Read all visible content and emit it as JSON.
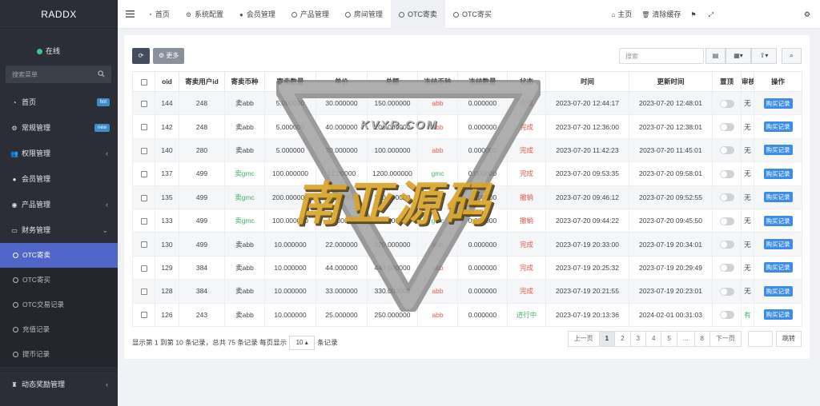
{
  "brand": "RADDX",
  "user": {
    "status": "在线"
  },
  "sidebar_search": {
    "placeholder": "搜索菜单"
  },
  "menu": {
    "home": {
      "label": "首页",
      "badge": "hot"
    },
    "general": {
      "label": "常规管理",
      "badge": "new"
    },
    "permission": {
      "label": "权限管理"
    },
    "member": {
      "label": "会员管理"
    },
    "product": {
      "label": "产品管理"
    },
    "finance": {
      "label": "财务管理"
    },
    "finance_sub": [
      "OTC寄卖",
      "OTC寄买",
      "OTC交易记录",
      "充值记录",
      "提币记录"
    ],
    "reward": {
      "label": "动态奖励管理"
    }
  },
  "tabs": [
    "首页",
    "系统配置",
    "会员管理",
    "产品管理",
    "房间管理",
    "OTC寄卖",
    "OTC寄买"
  ],
  "topright": {
    "home": "主页",
    "clear_cache": "清除缓存"
  },
  "toolbar": {
    "more": "更多"
  },
  "table_search": {
    "placeholder": "搜索"
  },
  "columns": [
    "oid",
    "寄卖用户id",
    "寄卖币种",
    "寄卖数量",
    "单价",
    "总额",
    "冻结币种",
    "冻结数量",
    "状态",
    "时间",
    "更新时间",
    "置顶",
    "审核",
    "操作"
  ],
  "rows": [
    {
      "oid": "144",
      "uid": "248",
      "coin": "卖abb",
      "qty": "5.000000",
      "price": "30.000000",
      "total": "150.000000",
      "fcoin": "abb",
      "fqty": "0.000000",
      "status": "完成",
      "time": "2023-07-20 12:44:17",
      "updated": "2023-07-20 12:48:01",
      "audit": "无",
      "action": "购买记录"
    },
    {
      "oid": "142",
      "uid": "248",
      "coin": "卖abb",
      "qty": "5.000000",
      "price": "40.000000",
      "total": "200.000000",
      "fcoin": "abb",
      "fqty": "0.000000",
      "status": "完成",
      "time": "2023-07-20 12:36:00",
      "updated": "2023-07-20 12:38:01",
      "audit": "无",
      "action": "购买记录"
    },
    {
      "oid": "140",
      "uid": "280",
      "coin": "卖abb",
      "qty": "5.000000",
      "price": "20.000000",
      "total": "100.000000",
      "fcoin": "abb",
      "fqty": "0.000000",
      "status": "完成",
      "time": "2023-07-20 11:42:23",
      "updated": "2023-07-20 11:45:01",
      "audit": "无",
      "action": "购买记录"
    },
    {
      "oid": "137",
      "uid": "499",
      "coin": "卖gmc",
      "qty": "100.000000",
      "price": "12.00000",
      "total": "1200.000000",
      "fcoin": "gmc",
      "fqty": "0.000000",
      "status": "完成",
      "time": "2023-07-20 09:53:35",
      "updated": "2023-07-20 09:58:01",
      "audit": "无",
      "action": "购买记录"
    },
    {
      "oid": "135",
      "uid": "499",
      "coin": "卖gmc",
      "qty": "200.000000",
      "price": "1.000000",
      "total": "200.000000",
      "fcoin": "gmc",
      "fqty": "0.000000",
      "status": "撤销",
      "time": "2023-07-20 09:46:12",
      "updated": "2023-07-20 09:52:55",
      "audit": "无",
      "action": "购买记录"
    },
    {
      "oid": "133",
      "uid": "499",
      "coin": "卖gmc",
      "qty": "100.000000",
      "price": "1.000000",
      "total": "100.000000",
      "fcoin": "gmc",
      "fqty": "0.000000",
      "status": "撤销",
      "time": "2023-07-20 09:44:22",
      "updated": "2023-07-20 09:45:50",
      "audit": "无",
      "action": "购买记录"
    },
    {
      "oid": "130",
      "uid": "499",
      "coin": "卖abb",
      "qty": "10.000000",
      "price": "22.000000",
      "total": "220.000000",
      "fcoin": "abb",
      "fqty": "0.000000",
      "status": "完成",
      "time": "2023-07-19 20:33:00",
      "updated": "2023-07-19 20:34:01",
      "audit": "无",
      "action": "购买记录"
    },
    {
      "oid": "129",
      "uid": "384",
      "coin": "卖abb",
      "qty": "10.000000",
      "price": "44.000000",
      "total": "440.000000",
      "fcoin": "abb",
      "fqty": "0.000000",
      "status": "完成",
      "time": "2023-07-19 20:25:32",
      "updated": "2023-07-19 20:29:49",
      "audit": "无",
      "action": "购买记录"
    },
    {
      "oid": "128",
      "uid": "384",
      "coin": "卖abb",
      "qty": "10.000000",
      "price": "33.000000",
      "total": "330.000000",
      "fcoin": "abb",
      "fqty": "0.000000",
      "status": "完成",
      "time": "2023-07-19 20:21:55",
      "updated": "2023-07-19 20:23:01",
      "audit": "无",
      "action": "购买记录"
    },
    {
      "oid": "126",
      "uid": "243",
      "coin": "卖abb",
      "qty": "10.000000",
      "price": "25.000000",
      "total": "250.000000",
      "fcoin": "abb",
      "fqty": "0.000000",
      "status": "进行中",
      "time": "2023-07-19 20:13:36",
      "updated": "2024-02-01 00:31:03",
      "audit": "有",
      "action": "购买记录"
    }
  ],
  "footer": {
    "summary": "显示第 1 到第 10 条记录，总共 75 条记录 每页显示",
    "page_size": "10",
    "suffix": "条记录"
  },
  "pager": {
    "prev": "上一页",
    "pages": [
      "1",
      "2",
      "3",
      "4",
      "5",
      "...",
      "8"
    ],
    "next": "下一页",
    "jump": "跳转"
  },
  "watermark": {
    "top": "KVXR.COM",
    "main": "南亚源码"
  },
  "colors": {
    "sidebar": "#2b2e36",
    "active": "#5066c9",
    "done": "#e05b4f",
    "progress": "#45b36c",
    "record_btn": "#3d8ce6"
  }
}
